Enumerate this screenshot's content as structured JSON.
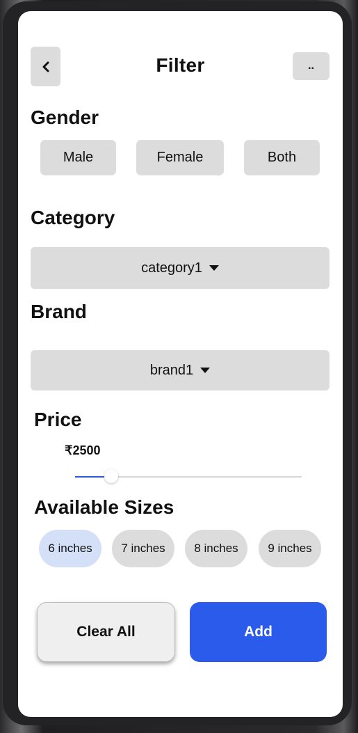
{
  "header": {
    "title": "Filter",
    "back_icon": "chevron-left-icon",
    "menu_label": ".."
  },
  "gender": {
    "title": "Gender",
    "options": [
      "Male",
      "Female",
      "Both"
    ]
  },
  "category": {
    "title": "Category",
    "selected": "category1",
    "icon": "caret-down-icon"
  },
  "brand": {
    "title": "Brand",
    "selected": "brand1",
    "icon": "caret-down-icon"
  },
  "price": {
    "title": "Price",
    "value_label": "₹2500",
    "slider_fraction": 0.16
  },
  "sizes": {
    "title": "Available Sizes",
    "options": [
      "6 inches",
      "7 inches",
      "8 inches",
      "9 inches"
    ],
    "selected_index": 0
  },
  "actions": {
    "clear_label": "Clear All",
    "add_label": "Add"
  },
  "colors": {
    "accent": "#2a5bea",
    "chip": "#dcdcdc",
    "chip_selected": "#d3e0f8"
  }
}
